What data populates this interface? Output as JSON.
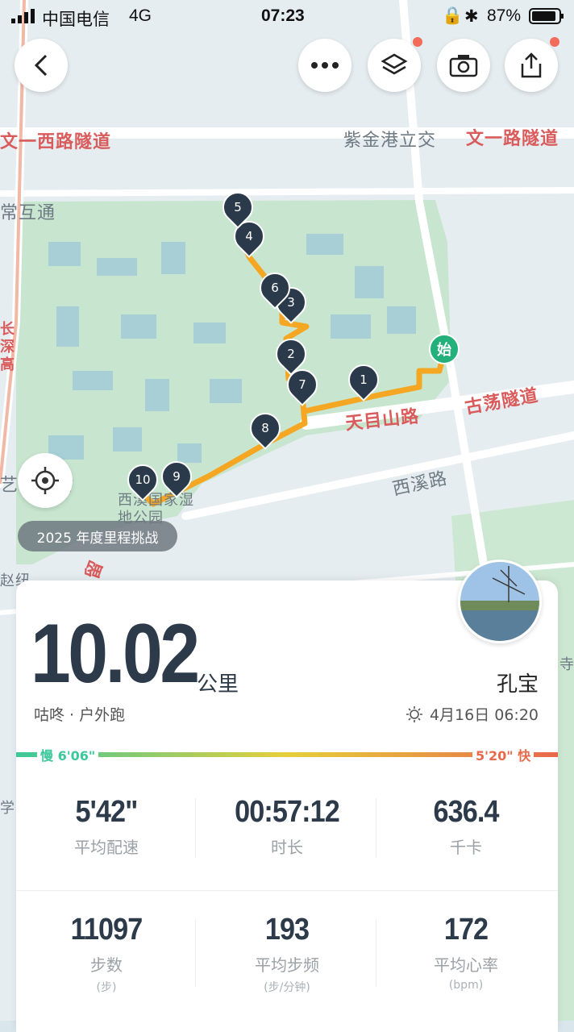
{
  "status_bar": {
    "carrier": "中国电信",
    "network": "4G",
    "time": "07:23",
    "battery": "87%"
  },
  "map": {
    "labels": {
      "road1": "文一西路隧道",
      "interchange": "紫金港立交",
      "road2": "文一路隧道",
      "changhu": "常互通",
      "tianmu": "天目山路",
      "gudang": "古荡隧道",
      "xixi_road": "西溪路",
      "village": "艺术谷村",
      "park": "西溪国家湿地公园",
      "left_edge": "长深高",
      "bottom_left": "赵纽",
      "liu": "留",
      "xue": "学",
      "si": "寺"
    },
    "start_label": "始",
    "markers": [
      "1",
      "2",
      "3",
      "4",
      "5",
      "6",
      "7",
      "8",
      "9",
      "10"
    ],
    "route_color": "#f5a623",
    "marker_color": "#2b3a4a",
    "park_color": "#bfe3c8"
  },
  "buttons": {
    "back": "back",
    "more": "more",
    "layers": "layers",
    "camera": "camera",
    "share": "share"
  },
  "challenge": "2025 年度里程挑战",
  "summary": {
    "distance": "10.02",
    "unit": "公里",
    "source": "咕咚 · 户外跑",
    "name": "孔宝",
    "date": "4月16日 06:20"
  },
  "pace_bar": {
    "slow": "慢 6'06\"",
    "fast": "5'20\" 快",
    "slow_color": "#3cc89a",
    "fast_color": "#e8694a"
  },
  "stats": [
    {
      "value": "5'42\"",
      "label": "平均配速",
      "unit": ""
    },
    {
      "value": "00:57:12",
      "label": "时长",
      "unit": ""
    },
    {
      "value": "636.4",
      "label": "千卡",
      "unit": ""
    },
    {
      "value": "11097",
      "label": "步数",
      "unit": "(步)"
    },
    {
      "value": "193",
      "label": "平均步频",
      "unit": "(步/分钟)"
    },
    {
      "value": "172",
      "label": "平均心率",
      "unit": "(bpm)"
    }
  ]
}
